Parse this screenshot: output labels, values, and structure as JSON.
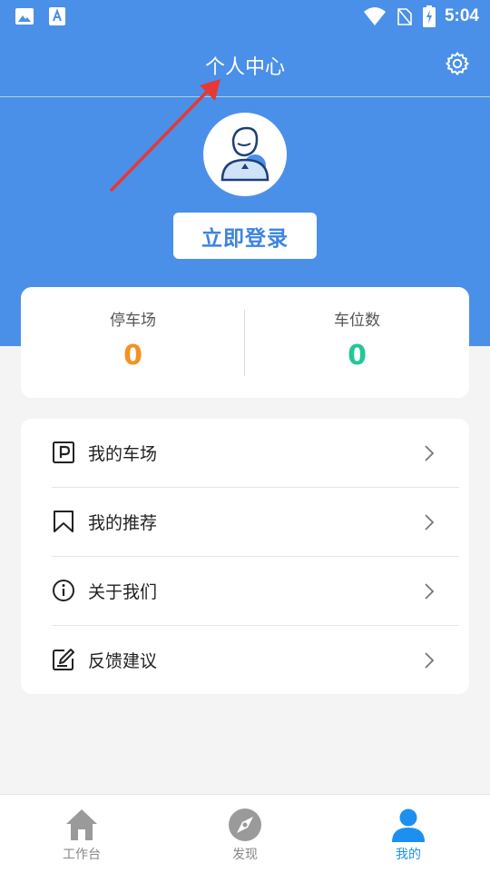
{
  "status_bar": {
    "time": "5:04"
  },
  "header": {
    "title": "个人中心"
  },
  "profile": {
    "login_label": "立即登录"
  },
  "stats": [
    {
      "label": "停车场",
      "value": "0",
      "color": "#f39220"
    },
    {
      "label": "车位数",
      "value": "0",
      "color": "#22c79a"
    }
  ],
  "menu": [
    {
      "label": "我的车场",
      "icon": "parking-icon"
    },
    {
      "label": "我的推荐",
      "icon": "bookmark-icon"
    },
    {
      "label": "关于我们",
      "icon": "info-icon"
    },
    {
      "label": "反馈建议",
      "icon": "edit-icon"
    }
  ],
  "tabs": [
    {
      "label": "工作台",
      "icon": "home-icon",
      "active": false
    },
    {
      "label": "发现",
      "icon": "compass-icon",
      "active": false
    },
    {
      "label": "我的",
      "icon": "user-icon",
      "active": true
    }
  ],
  "colors": {
    "primary": "#4a90e8",
    "tab_active": "#1d8ff0",
    "tab_inactive": "#888888",
    "annotation_arrow": "#e53935"
  }
}
